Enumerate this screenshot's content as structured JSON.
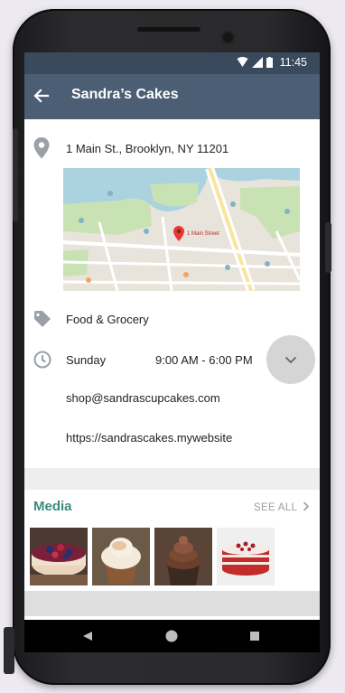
{
  "status_bar": {
    "time": "11:45"
  },
  "app_bar": {
    "title": "Sandra’s Cakes",
    "back_icon": "arrow-left-icon"
  },
  "details": {
    "address": "1 Main St., Brooklyn, NY 11201",
    "category": "Food & Grocery",
    "hours": {
      "day": "Sunday",
      "time": "9:00 AM - 6:00 PM"
    },
    "email": "shop@sandrascupcakes.com",
    "website": "https://sandrascakes.mywebsite"
  },
  "map": {
    "pin_label": "1 Main Street"
  },
  "media": {
    "title": "Media",
    "see_all": "SEE ALL",
    "thumbnails": [
      "berry-cheesecake",
      "meringue-cupcake",
      "chocolate-cupcake",
      "red-velvet-cake"
    ]
  },
  "colors": {
    "status_bar": "#394a5d",
    "app_bar": "#4b5e74",
    "accent": "#3c8b80",
    "icon_gray": "#9aa0a6"
  }
}
